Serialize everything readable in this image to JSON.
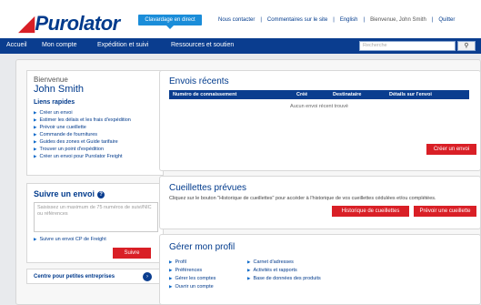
{
  "header": {
    "logo_text": "Purolator",
    "chat_label": "Clavardage en direct",
    "links": [
      "Nous contacter",
      "Commentaires sur le site",
      "English"
    ],
    "user_greeting": "Bienvenue, John Smith",
    "logout": "Quitter"
  },
  "nav": {
    "items": [
      "Accueil",
      "Mon compte",
      "Expédition et suivi",
      "Ressources et soutien"
    ],
    "search_placeholder": "Recherche"
  },
  "sidebar": {
    "welcome": "Bienvenue",
    "username": "John Smith",
    "quick_links_title": "Liens rapides",
    "quick_links": [
      "Créer un envoi",
      "Estimer les délais et les frais d'expédition",
      "Prévoir une cueillette",
      "Commande de fournitures",
      "Guides des zones et Guide tarifaire",
      "Trouver un point d'expédition",
      "Créer un envoi pour Purolator Freight"
    ],
    "track": {
      "title": "Suivre un envoi",
      "placeholder": "Saisissez un maximum de 75 numéros de suivi/NIC ou références",
      "freight_link": "Suivre un envoi CP de Freight",
      "button": "Suivre"
    },
    "small_business": "Centre pour petites entreprises"
  },
  "recent": {
    "title": "Envois récents",
    "columns": [
      "Numéro de connaissement",
      "Créé",
      "Destinataire",
      "Détails sur l'envoi"
    ],
    "empty": "Aucun envoi récent trouvé",
    "create_button": "Créer un envoi"
  },
  "pickups": {
    "title": "Cueillettes prévues",
    "description": "Cliquez sur le bouton \"Historique de cueillettes\" pour accéder à l'historique de vos cueillettes cédulées et/ou complétées.",
    "history_button": "Historique de cueillettes",
    "plan_button": "Prévoir une cueillette"
  },
  "profile": {
    "title": "Gérer mon profil",
    "col1": [
      "Profil",
      "Préférences",
      "Gérer les comptes",
      "Ouvrir un compte"
    ],
    "col2": [
      "Carnet d'adresses",
      "Activités et rapports",
      "Base de données des produits"
    ]
  }
}
